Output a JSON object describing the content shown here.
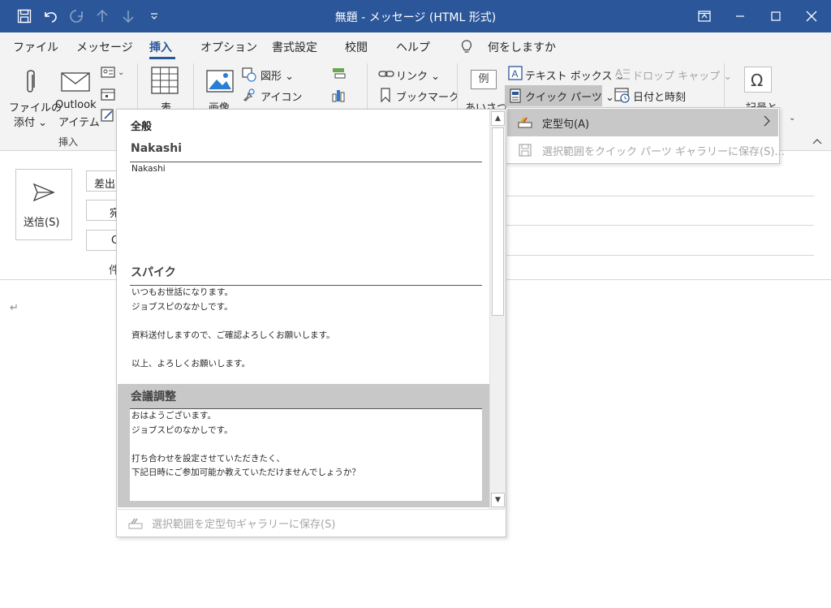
{
  "window": {
    "title": "無題  -  メッセージ (HTML 形式)"
  },
  "tabs": [
    {
      "label": "ファイル"
    },
    {
      "label": "メッセージ"
    },
    {
      "label": "挿入"
    },
    {
      "label": "オプション"
    },
    {
      "label": "書式設定"
    },
    {
      "label": "校閲"
    },
    {
      "label": "ヘルプ"
    },
    {
      "label": "何をしますか"
    }
  ],
  "ribbon": {
    "attach_file": {
      "line1": "ファイルの",
      "line2": "添付 ⌄"
    },
    "outlook_item": {
      "line1": "Outlook",
      "line2": "アイテム"
    },
    "insert_group": "挿入",
    "table": "表",
    "picture": "画像",
    "shapes": "図形 ⌄",
    "icons": "アイコン",
    "link": "リンク ⌄",
    "bookmark": "ブックマーク",
    "greeting_sample": "例",
    "greeting": "あいさつ",
    "textbox": "テキスト ボックス ⌄",
    "dropcap": "ドロップ キャップ ⌄",
    "quickparts": "クイック パーツ ⌄",
    "datetime": "日付と時刻",
    "symbol": "記号と"
  },
  "compose": {
    "send": "送信(S)",
    "from_partial": "差出",
    "to_partial": "宛",
    "cc_partial": "C",
    "subject_partial": "件"
  },
  "submenu": {
    "autotext": "定型句(A)",
    "save_to_gallery": "選択範囲をクイック パーツ ギャラリーに保存(S)..."
  },
  "gallery": {
    "heading": "全般",
    "entries": [
      {
        "name": "Nakashi",
        "lines": [
          "Nakashi"
        ]
      },
      {
        "name": "スパイク",
        "lines": [
          "いつもお世話になります。",
          "ジョブスピのなかしです。",
          "",
          "資料送付しますので、ご確認よろしくお願いします。",
          "",
          "以上、よろしくお願いします。"
        ]
      },
      {
        "name": "会議調整",
        "lines": [
          "おはようございます。",
          "ジョブスピのなかしです。",
          "",
          "打ち合わせを設定させていただきたく、",
          "下記日時にご参加可能か教えていただけませんでしょうか？"
        ]
      }
    ],
    "footer": "選択範囲を定型句ギャラリーに保存(S)"
  }
}
